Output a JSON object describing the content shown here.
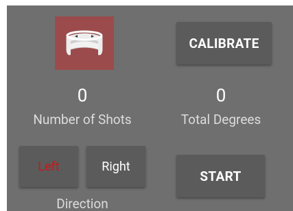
{
  "icons": {
    "ring": "ring-icon"
  },
  "colors": {
    "panel_bg": "#6f6f6f",
    "button_bg": "#5b5b5b",
    "icon_tile_bg": "#9b4b4b",
    "active_direction": "#d01515",
    "text": "#ffffff"
  },
  "calibrate_label": "CALIBRATE",
  "stats": {
    "shots_value": "0",
    "shots_label": "Number of Shots",
    "degrees_value": "0",
    "degrees_label": "Total Degrees"
  },
  "direction": {
    "left_label": "Left",
    "right_label": "Right",
    "label": "Direction",
    "selected": "Left"
  },
  "start_label": "START"
}
